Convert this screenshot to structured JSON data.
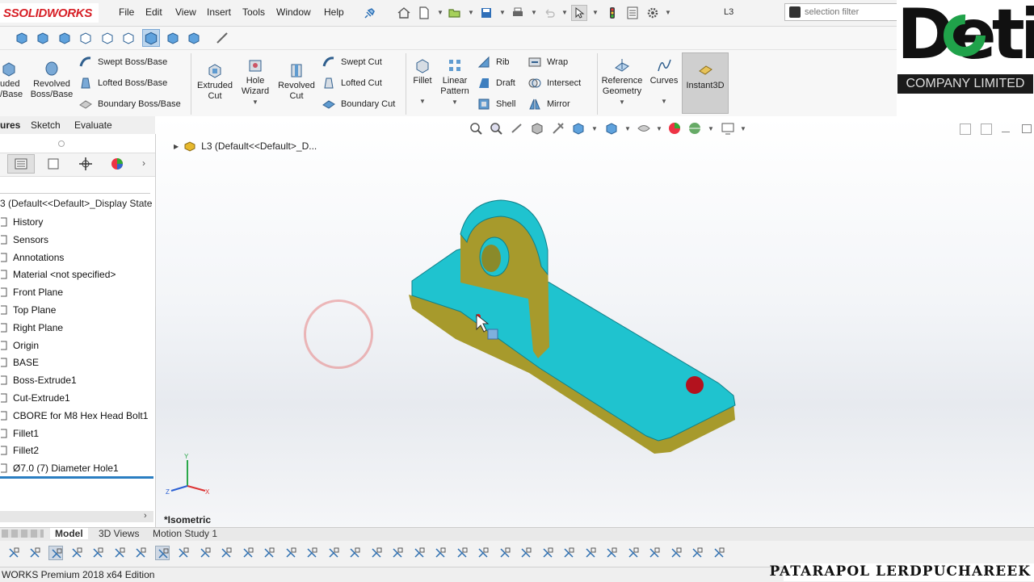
{
  "app": {
    "brand_prefix": "S ",
    "brand_name": "SOLIDWORKS",
    "edition": "WORKS Premium 2018 x64 Edition"
  },
  "menu": {
    "items": [
      "File",
      "Edit",
      "View",
      "Insert",
      "Tools",
      "Window",
      "Help"
    ]
  },
  "document": {
    "title": "L3"
  },
  "search": {
    "placeholder": "selection filter"
  },
  "company": {
    "wordmark": "Deti",
    "subtitle": "COMPANY LIMITED"
  },
  "command_manager": {
    "features_big": [
      {
        "label": "uded\n/Base",
        "icon": "extruded-boss-icon"
      },
      {
        "label": "Revolved\nBoss/Base",
        "icon": "revolved-boss-icon"
      }
    ],
    "features_stack1": [
      "Swept Boss/Base",
      "Lofted Boss/Base",
      "Boundary Boss/Base"
    ],
    "cut_big": [
      {
        "label": "Extruded\nCut",
        "icon": "extruded-cut-icon"
      },
      {
        "label": "Hole\nWizard",
        "icon": "hole-wizard-icon"
      },
      {
        "label": "Revolved\nCut",
        "icon": "revolved-cut-icon"
      }
    ],
    "cut_stack": [
      "Swept Cut",
      "Lofted Cut",
      "Boundary Cut"
    ],
    "mod_big": [
      {
        "label": "Fillet",
        "icon": "fillet-icon"
      },
      {
        "label": "Linear\nPattern",
        "icon": "linear-pattern-icon"
      }
    ],
    "mod_stack1": [
      "Rib",
      "Draft",
      "Shell"
    ],
    "mod_stack2": [
      "Wrap",
      "Intersect",
      "Mirror"
    ],
    "ref_big": [
      {
        "label": "Reference\nGeometry",
        "icon": "reference-geometry-icon"
      },
      {
        "label": "Curves",
        "icon": "curves-icon"
      }
    ],
    "instant3d": "Instant3D"
  },
  "tabs": [
    "ures",
    "Sketch",
    "Evaluate"
  ],
  "tree": {
    "root": "3  (Default<<Default>_Display State ",
    "items": [
      "History",
      "Sensors",
      "Annotations",
      "Material <not specified>",
      "Front Plane",
      "Top Plane",
      "Right Plane",
      "Origin",
      "BASE",
      "Boss-Extrude1",
      "Cut-Extrude1",
      "CBORE for M8 Hex Head Bolt1",
      "Fillet1",
      "Fillet2",
      "Ø7.0 (7) Diameter Hole1"
    ]
  },
  "graphics": {
    "breadcrumb": "L3  (Default<<Default>_D...",
    "view_name": "*Isometric",
    "triad_labels": {
      "x": "X",
      "y": "Y",
      "z": "Z"
    }
  },
  "bottom_tabs": [
    "Model",
    "3D Views",
    "Motion Study 1"
  ],
  "watermark": "PATARAPOL LERDPUCHAREEK",
  "colors": {
    "model_face": "#1fc3cf",
    "model_side": "#a79a2c",
    "accent": "#2a7ec2",
    "brand": "#d71f26"
  }
}
